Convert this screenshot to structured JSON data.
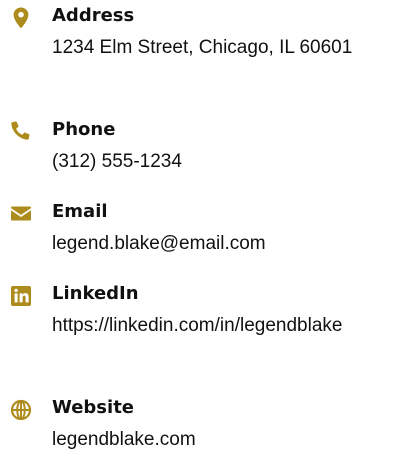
{
  "accent_color": "#ad8b1c",
  "contacts": [
    {
      "label": "Address",
      "value": "1234 Elm Street, Chicago, IL 60601",
      "icon": "map-pin-icon"
    },
    {
      "label": "Phone",
      "value": "(312) 555-1234",
      "icon": "phone-icon"
    },
    {
      "label": "Email",
      "value": "legend.blake@email.com",
      "icon": "envelope-icon"
    },
    {
      "label": "LinkedIn",
      "value": "https://linkedin.com/in/legendblake",
      "icon": "linkedin-icon"
    },
    {
      "label": "Website",
      "value": "legendblake.com",
      "icon": "globe-icon"
    }
  ]
}
